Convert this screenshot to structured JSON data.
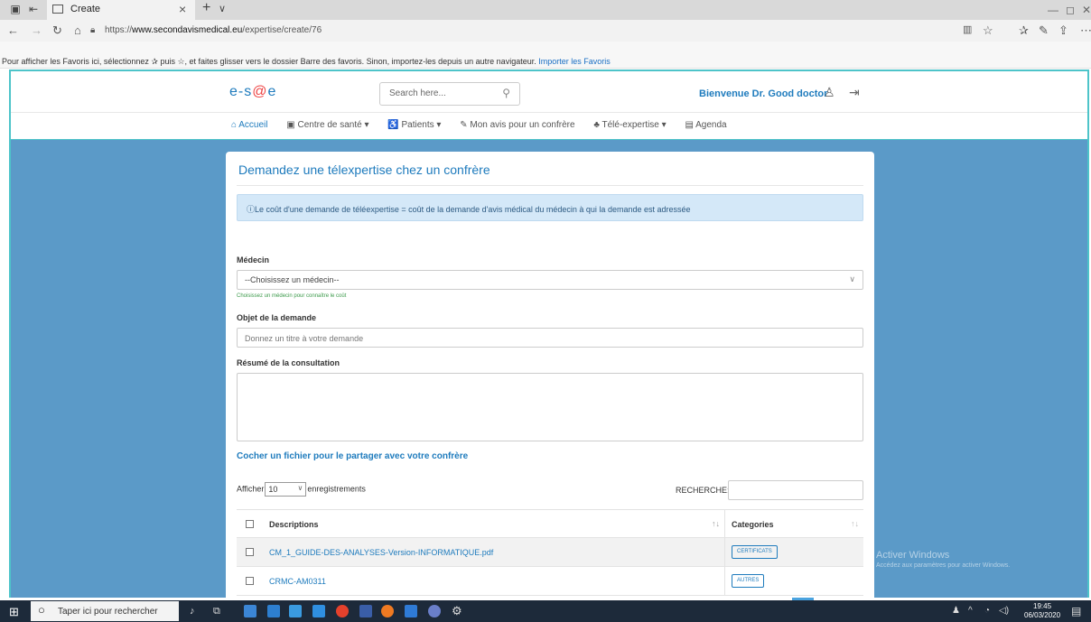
{
  "browser": {
    "tab_title": "Create",
    "tab_close": "×",
    "new_tab": "+",
    "tab_menu": "∨",
    "url_prefix": "https://",
    "url_domain": "www.secondavismedical.eu",
    "url_path": "/expertise/create/76",
    "favorites_text": "Pour afficher les Favoris ici, sélectionnez ✰ puis ☆, et faites glisser vers le dossier Barre des favoris. Sinon, importez-les depuis un autre navigateur.",
    "favorites_link": "Importer les Favoris"
  },
  "header": {
    "logo_part1": "e-s",
    "logo_part2": "@",
    "logo_part3": "e",
    "search_placeholder": "Search here...",
    "welcome": "Bienvenue Dr. Good doctor"
  },
  "nav": {
    "items": [
      {
        "label": "⌂ Accueil"
      },
      {
        "label": "▣ Centre de santé ▾"
      },
      {
        "label": "♿ Patients ▾"
      },
      {
        "label": "✎ Mon avis pour un confrère"
      },
      {
        "label": "♣ Télé-expertise ▾"
      },
      {
        "label": "▤ Agenda"
      }
    ]
  },
  "form": {
    "title": "Demandez une télexpertise chez un confrère",
    "alert": "ⓘLe coût d'une demande de téléexpertise = coût de la demande d'avis médical du médecin à qui la demande est adressée",
    "medecin_label": "Médecin",
    "medecin_value": "--Choisissez un médecin--",
    "medecin_hint": "Choisissez un médecin pour connaître le coût",
    "objet_label": "Objet de la demande",
    "objet_placeholder": "Donnez un titre à votre demande",
    "resume_label": "Résumé de la consultation",
    "upload_link": "Cocher un fichier pour le partager avec votre confrère"
  },
  "table": {
    "length_prefix": "Afficher",
    "length_value": "10",
    "length_suffix": "enregistrements",
    "search_label": "RECHERCHE:",
    "columns": [
      "Descriptions",
      "Categories"
    ],
    "rows": [
      {
        "description": "CM_1_GUIDE-DES-ANALYSES-Version-INFORMATIQUE.pdf",
        "category": "CERTIFICATS"
      },
      {
        "description": "CRMC-AM0311",
        "category": "AUTRES"
      }
    ]
  },
  "watermark": {
    "line1": "Activer Windows",
    "line2": "Accédez aux paramètres pour activer Windows."
  },
  "taskbar": {
    "search_placeholder": "Taper ici pour rechercher",
    "time": "19:45",
    "date": "06/03/2020"
  }
}
